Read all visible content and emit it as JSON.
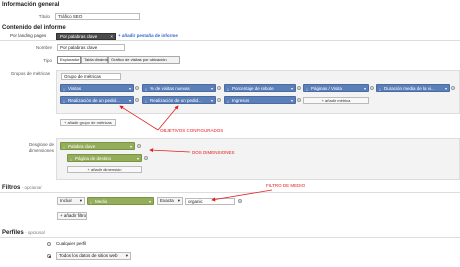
{
  "general": {
    "heading": "Información general",
    "title_label": "Título",
    "title_value": "Tráfico SEO"
  },
  "content": {
    "heading": "Contenido del informe",
    "tab_source": "Por landing pages",
    "tab_active": "Por palabras clave",
    "tab_add": "+ añadir pestaña de informe",
    "name_label": "Nombre",
    "name_value": "Por palabras clave",
    "type_label": "Tipo",
    "type_options": [
      "Explorador",
      "Tabla dinámica",
      "Gráfico de visitas por ubicación"
    ],
    "metric_groups_label": "Grupos de métricas",
    "metric_group_name": "Grupo de métricas",
    "metrics": [
      "Visitas",
      "% de visitas nuevas",
      "Porcentaje de rebote",
      "Páginas / Visita",
      "Duración media de la vi...",
      "Realización de un pedid...",
      "Realización de un pedid...",
      "Ingresos"
    ],
    "add_metric": "+ añadir métrica",
    "add_metric_group": "+ añadir grupo de métricas",
    "dimensions_label": "Desglose de dimensiones",
    "dimensions": [
      "Palabra clave",
      "Página de destino"
    ],
    "add_dimension": "+ añadir dimensión"
  },
  "filters": {
    "heading": "Filtros",
    "optional": "- opcional",
    "mode": "Incluir",
    "dimension": "Medio",
    "match": "Exacta",
    "value": "organic",
    "add_filter": "+ añadir filtro"
  },
  "profiles": {
    "heading": "Perfiles",
    "optional": "- opcional",
    "any_profile": "Cualquier perfil",
    "selected_profile": "Todos los datos de sitios web"
  },
  "annotations": {
    "goals": "OBJETIVOS CONFIGURADOS",
    "dimensions": "DOS DIMENSIONES",
    "filter": "FILTRO DE MEDIO"
  },
  "colors": {
    "metric_chip": "#5b7fb8",
    "dimension_chip": "#93ad5b",
    "annotation": "#e02020"
  }
}
